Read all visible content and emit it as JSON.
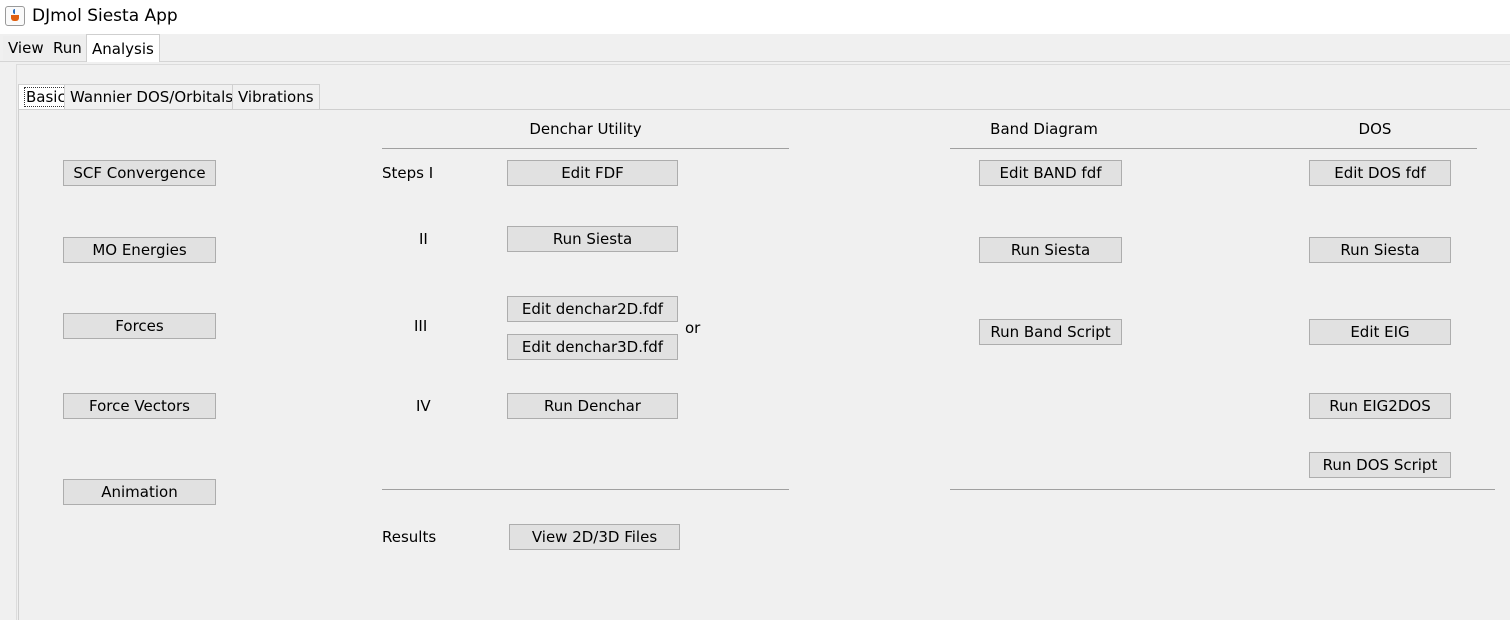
{
  "window": {
    "title": "DJmol Siesta App"
  },
  "top_tabs": [
    "View",
    "Run",
    "Analysis"
  ],
  "sub_tabs": [
    "Basic",
    "Wannier DOS/Orbitals",
    "Vibrations"
  ],
  "basic": {
    "left_buttons": [
      "SCF Convergence",
      "MO Energies",
      "Forces",
      "Force Vectors",
      "Animation"
    ],
    "denchar": {
      "title": "Denchar Utility",
      "steps_label": "Steps I",
      "step_ii": "II",
      "step_iii": "III",
      "step_iv": "IV",
      "edit_fdf": "Edit FDF",
      "run_siesta": "Run Siesta",
      "edit_2d": "Edit denchar2D.fdf",
      "or_label": "or",
      "edit_3d": "Edit denchar3D.fdf",
      "run_denchar": "Run Denchar",
      "results_label": "Results",
      "view_files": "View 2D/3D Files"
    },
    "band": {
      "title": "Band Diagram",
      "edit_fdf": "Edit BAND fdf",
      "run_siesta": "Run Siesta",
      "run_script": "Run Band Script"
    },
    "dos": {
      "title": "DOS",
      "edit_fdf": "Edit DOS fdf",
      "run_siesta": "Run Siesta",
      "edit_eig": "Edit EIG",
      "run_eig2dos": "Run EIG2DOS",
      "run_script": "Run DOS Script"
    }
  }
}
